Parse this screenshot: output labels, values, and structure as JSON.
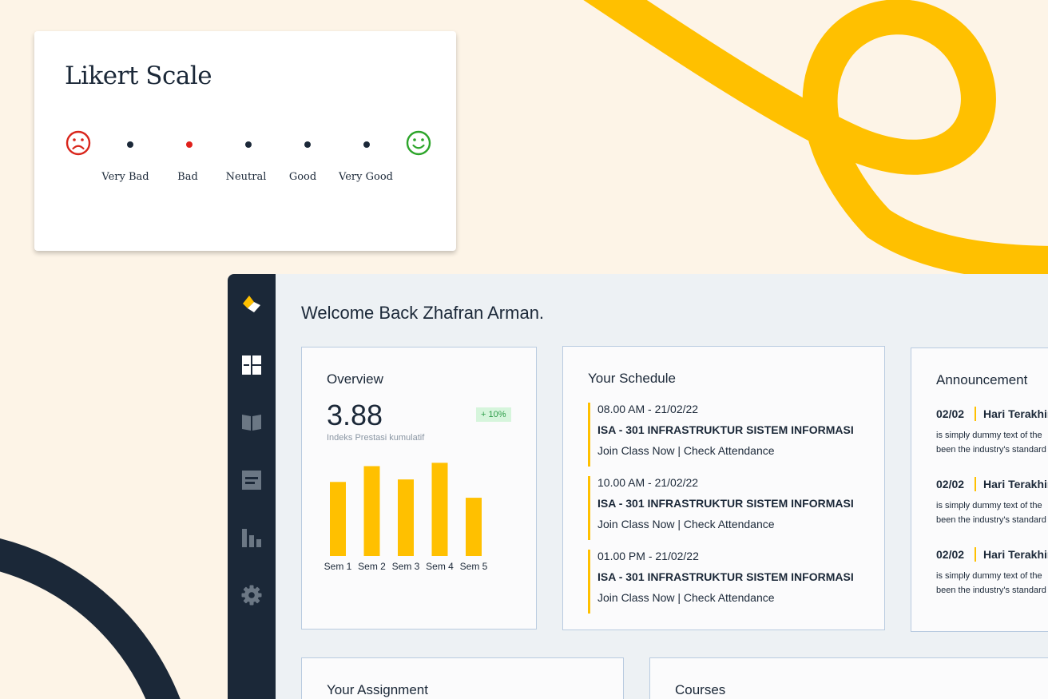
{
  "likert": {
    "title": "Likert Scale",
    "labels": [
      "Very Bad",
      "Bad",
      "Neutral",
      "Good",
      "Very Good"
    ],
    "selected_index": 1,
    "colors": {
      "dot": "#1b2838",
      "selected": "#e0201b",
      "sad": "#d9261c",
      "happy": "#2da52a"
    }
  },
  "app": {
    "welcome": "Welcome Back Zhafran Arman.",
    "nav_icons": [
      "logo-icon",
      "dashboard-icon",
      "book-icon",
      "document-icon",
      "bar-chart-icon",
      "gear-icon"
    ],
    "overview": {
      "title": "Overview",
      "gpa": "3.88",
      "badge": "+ 10%",
      "caption": "Indeks Prestasi kumulatif"
    },
    "schedule": {
      "title": "Your Schedule",
      "items": [
        {
          "time": "08.00 AM - 21/02/22",
          "course": "ISA - 301 INFRASTRUKTUR SISTEM INFORMASI",
          "join": "Join Class Now",
          "attendance": "Check Attendance"
        },
        {
          "time": "10.00 AM - 21/02/22",
          "course": "ISA - 301 INFRASTRUKTUR SISTEM INFORMASI",
          "join": "Join Class Now",
          "attendance": "Check Attendance"
        },
        {
          "time": "01.00 PM - 21/02/22",
          "course": "ISA - 301 INFRASTRUKTUR SISTEM INFORMASI",
          "join": "Join Class Now",
          "attendance": "Check Attendance"
        }
      ]
    },
    "announcement": {
      "title": "Announcement",
      "items": [
        {
          "date": "02/02",
          "headline": "Hari Terakhir",
          "line1": "is simply dummy text of the",
          "line2": "been the industry's standard"
        },
        {
          "date": "02/02",
          "headline": "Hari Terakhir",
          "line1": "is simply dummy text of the",
          "line2": "been the industry's standard"
        },
        {
          "date": "02/02",
          "headline": "Hari Terakhir",
          "line1": "is simply dummy text of the",
          "line2": "been the industry's standard"
        }
      ]
    },
    "assignment": {
      "title": "Your Assignment"
    },
    "courses": {
      "title": "Courses"
    },
    "colors": {
      "accent": "#ffc000",
      "sidebar": "#1b2838"
    }
  },
  "chart_data": {
    "type": "bar",
    "categories": [
      "Sem 1",
      "Sem 2",
      "Sem 3",
      "Sem 4",
      "Sem 5"
    ],
    "values": [
      89,
      108,
      92,
      112,
      70
    ],
    "ylim": [
      0,
      120
    ],
    "grid": false,
    "color": "#ffc000"
  }
}
